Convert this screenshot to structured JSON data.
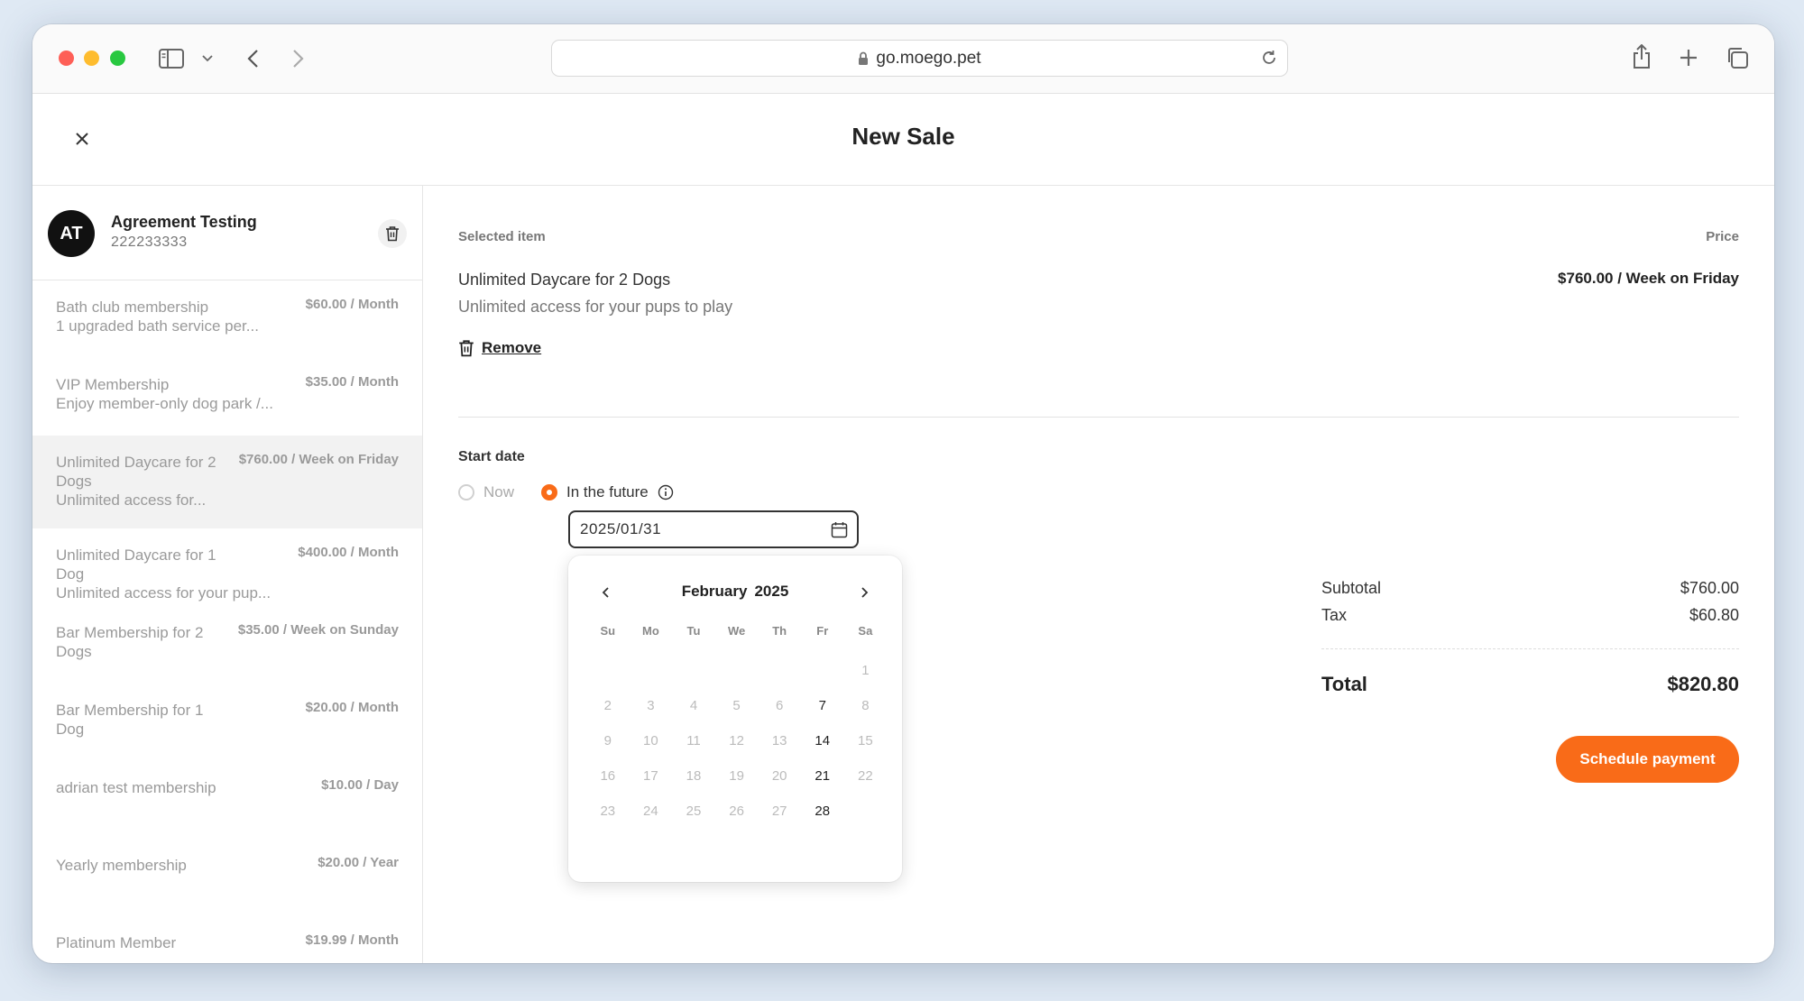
{
  "browser": {
    "url": "go.moego.pet"
  },
  "page": {
    "title": "New Sale"
  },
  "client": {
    "initials": "AT",
    "name": "Agreement Testing",
    "phone": "222233333"
  },
  "plans": [
    {
      "name": "Bath club membership",
      "price": "$60.00 / Month",
      "desc": "1 upgraded bath service per..."
    },
    {
      "name": "VIP Membership",
      "price": "$35.00 / Month",
      "desc": "Enjoy member-only dog park /..."
    },
    {
      "name": "Unlimited Daycare for 2 Dogs",
      "price": "$760.00 / Week on Friday",
      "desc": "Unlimited access for...",
      "selected": true
    },
    {
      "name": "Unlimited Daycare for 1 Dog",
      "price": "$400.00 / Month",
      "desc": "Unlimited access for your pup..."
    },
    {
      "name": "Bar Membership for 2 Dogs",
      "price": "$35.00 / Week on Sunday",
      "desc": ""
    },
    {
      "name": "Bar Membership for 1 Dog",
      "price": "$20.00 / Month",
      "desc": ""
    },
    {
      "name": "adrian test membership",
      "price": "$10.00 / Day",
      "desc": ""
    },
    {
      "name": "Yearly membership",
      "price": "$20.00 / Year",
      "desc": ""
    },
    {
      "name": "Platinum Member",
      "price": "$19.99 / Month",
      "desc": ""
    }
  ],
  "selected_item": {
    "section_label": "Selected item",
    "price_label": "Price",
    "name": "Unlimited Daycare for 2 Dogs",
    "desc": "Unlimited access for your pups to play",
    "price": "$760.00 / Week on Friday",
    "remove_label": "Remove"
  },
  "start_date": {
    "label": "Start date",
    "option_now": "Now",
    "option_future": "In the future",
    "value": "2025/01/31"
  },
  "calendar": {
    "month": "February",
    "year": "2025",
    "weekdays": [
      "Su",
      "Mo",
      "Tu",
      "We",
      "Th",
      "Fr",
      "Sa"
    ],
    "first_weekday_index": 6,
    "days_in_month": 28,
    "enabled_days": [
      7,
      14,
      21,
      28
    ]
  },
  "totals": {
    "subtotal_label": "Subtotal",
    "subtotal": "$760.00",
    "tax_label": "Tax",
    "tax": "$60.80",
    "total_label": "Total",
    "total": "$820.80"
  },
  "actions": {
    "schedule_payment": "Schedule payment"
  },
  "colors": {
    "accent": "#f96b18"
  }
}
